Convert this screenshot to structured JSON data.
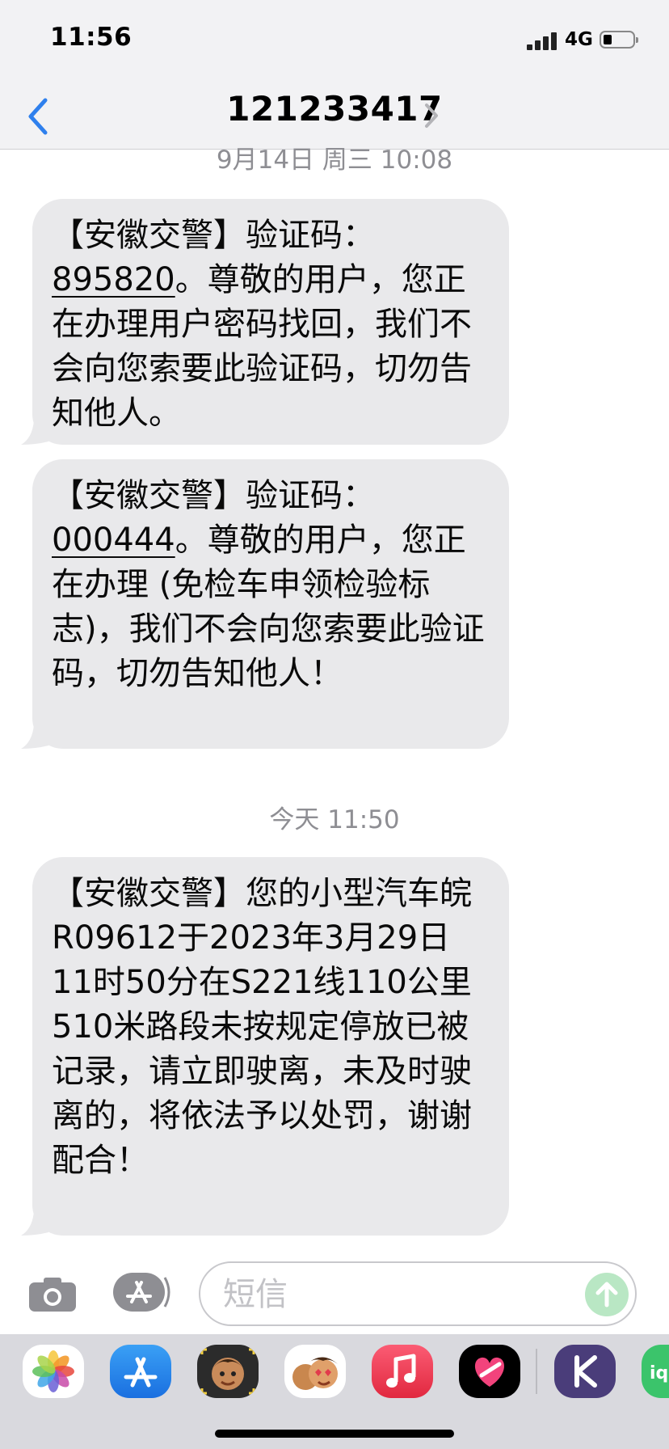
{
  "status_bar": {
    "time": "11:56",
    "network": "4G",
    "signal_bars": 4,
    "battery_level": 0.25
  },
  "header": {
    "title": "121233417",
    "back_icon": "chevron-left-icon",
    "details_icon": "chevron-right-icon"
  },
  "colors": {
    "accent": "#2f80ed",
    "bubble": "#e9e9eb",
    "timestamp": "#8e8e93",
    "send": "#b9e7c4"
  },
  "messages": [
    {
      "timestamp": "9月14日 周三 10:08"
    },
    {
      "prefix": "【安徽交警】验证码：",
      "code": "895820",
      "text": "。尊敬的用户，您正在办理用户密码找回，我们不会向您索要此验证码，切勿告知他人。"
    },
    {
      "prefix": "【安徽交警】验证码：",
      "code": "000444",
      "text": "。尊敬的用户，您正在办理 (免检车申领检验标志)，我们不会向您索要此验证码，切勿告知他人！"
    },
    {
      "timestamp": "今天 11:50"
    },
    {
      "text": "【安徽交警】您的小型汽车皖R09612于2023年3月29日11时50分在S221线110公里510米路段未按规定停放已被记录，请立即驶离，未及时驶离的，将依法予以处罚，谢谢配合！"
    }
  ],
  "input_bar": {
    "placeholder": "短信",
    "camera_icon": "camera-icon",
    "apps_icon": "app-store-icon",
    "send_icon": "arrow-up-icon"
  },
  "app_drawer": [
    "photos-icon",
    "app-store-icon",
    "memoji-icon",
    "animoji-icon",
    "music-icon",
    "digital-touch-icon",
    "k-app-icon",
    "iq-app-icon"
  ]
}
